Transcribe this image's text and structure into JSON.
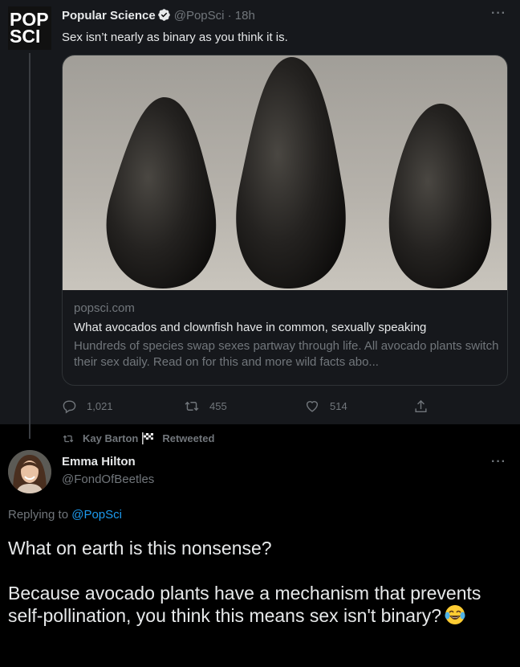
{
  "quoted_tweet": {
    "avatar_text_line1": "POP",
    "avatar_text_line2": "SCI",
    "name": "Popular Science",
    "handle_time": "@PopSci · 18h",
    "text": "Sex isn’t nearly as binary as you think it is.",
    "more_icon": "more-horizontal-icon",
    "card": {
      "image": "three-avocados-photo",
      "domain": "popsci.com",
      "title": "What avocados and clownfish have in common, sexually speaking",
      "description": "Hundreds of species swap sexes partway through life. All avocado plants switch their sex daily. Read on for this and more wild facts abo..."
    },
    "actions": {
      "replies": "1,021",
      "retweets": "455",
      "likes": "514"
    }
  },
  "retweet_banner": {
    "retweeter": "Kay Barton",
    "label": "Retweeted"
  },
  "reply_tweet": {
    "name": "Emma Hilton",
    "handle": "@FondOfBeetles",
    "replying_prefix": "Replying to",
    "replying_mention": "@PopSci",
    "line1": "What on earth is this nonsense?",
    "line2": "Because avocado plants have a mechanism that prevents self-pollination, you think this means sex isn't binary?",
    "emoji": "face-with-tears-of-joy"
  },
  "colors": {
    "background": "#000000",
    "quoted_background": "#16181c",
    "text_primary": "#e7e9ea",
    "text_secondary": "#71767b",
    "link": "#1d9bf0",
    "verified": "#e7e9ea"
  }
}
